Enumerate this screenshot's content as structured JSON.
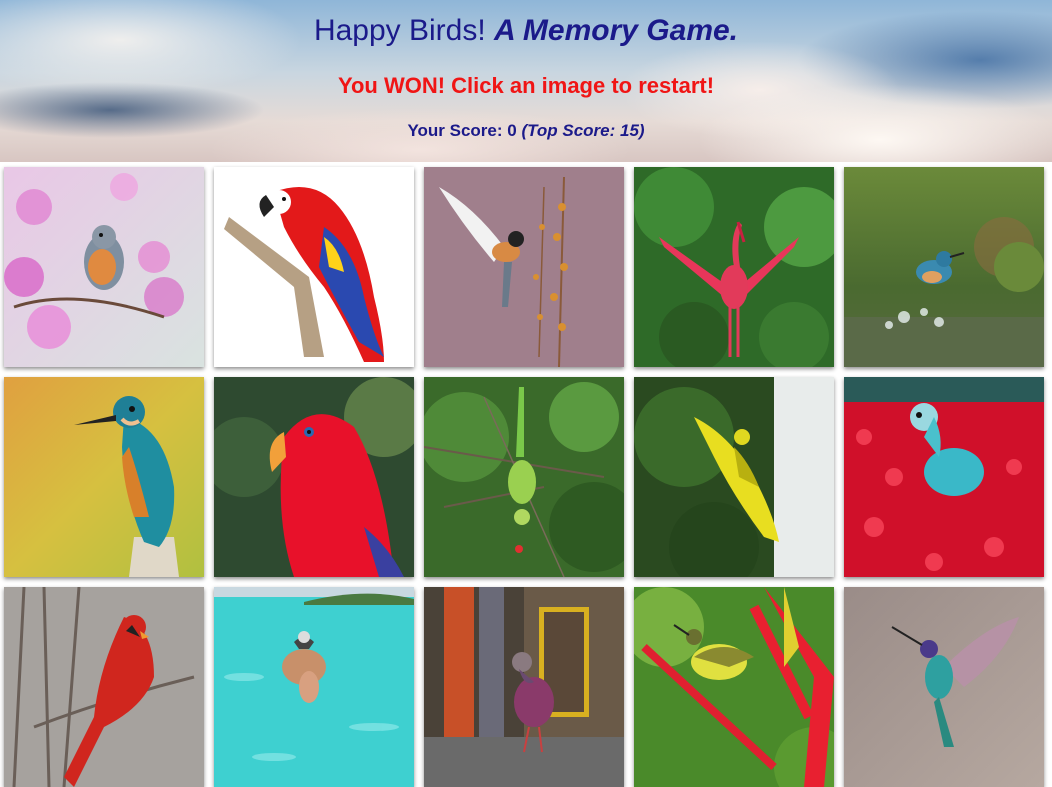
{
  "header": {
    "title_main": "Happy Birds!",
    "title_sub": "A Memory Game.",
    "message": "You WON! Click an image to restart!",
    "score_label": "Your Score: 0",
    "top_score_label": "(Top Score: 15)"
  },
  "cards": [
    {
      "name": "robin-blossom-card",
      "bird": "robin",
      "background": "pink blossoms"
    },
    {
      "name": "scarlet-macaw-card",
      "bird": "scarlet macaw",
      "background": "white"
    },
    {
      "name": "flying-finch-card",
      "bird": "finch in flight",
      "background": "mauve"
    },
    {
      "name": "red-ibis-card",
      "bird": "red ibis",
      "background": "green foliage"
    },
    {
      "name": "kingfisher-water-card",
      "bird": "kingfisher diving",
      "background": "pond"
    },
    {
      "name": "kingfisher-perch-card",
      "bird": "kingfisher",
      "background": "yellow"
    },
    {
      "name": "red-lory-card",
      "bird": "red lory",
      "background": "green"
    },
    {
      "name": "green-parakeet-card",
      "bird": "green parakeet",
      "background": "branches"
    },
    {
      "name": "yellow-parrot-card",
      "bird": "yellow parrot",
      "background": "forest"
    },
    {
      "name": "blue-lovebird-card",
      "bird": "blue lovebird",
      "background": "red petals"
    },
    {
      "name": "cardinal-card",
      "bird": "northern cardinal",
      "background": "grey branches"
    },
    {
      "name": "bird-on-pig-card",
      "bird": "bird on swimming pig",
      "background": "turquoise sea"
    },
    {
      "name": "pigeon-card",
      "bird": "pigeon",
      "background": "street"
    },
    {
      "name": "sunbird-card",
      "bird": "sunbird",
      "background": "red flowers"
    },
    {
      "name": "hummingbird-card",
      "bird": "hummingbird",
      "background": "grey"
    }
  ],
  "colors": {
    "title": "#1b1a8a",
    "message": "#f01515",
    "score": "#1b1a8a"
  }
}
